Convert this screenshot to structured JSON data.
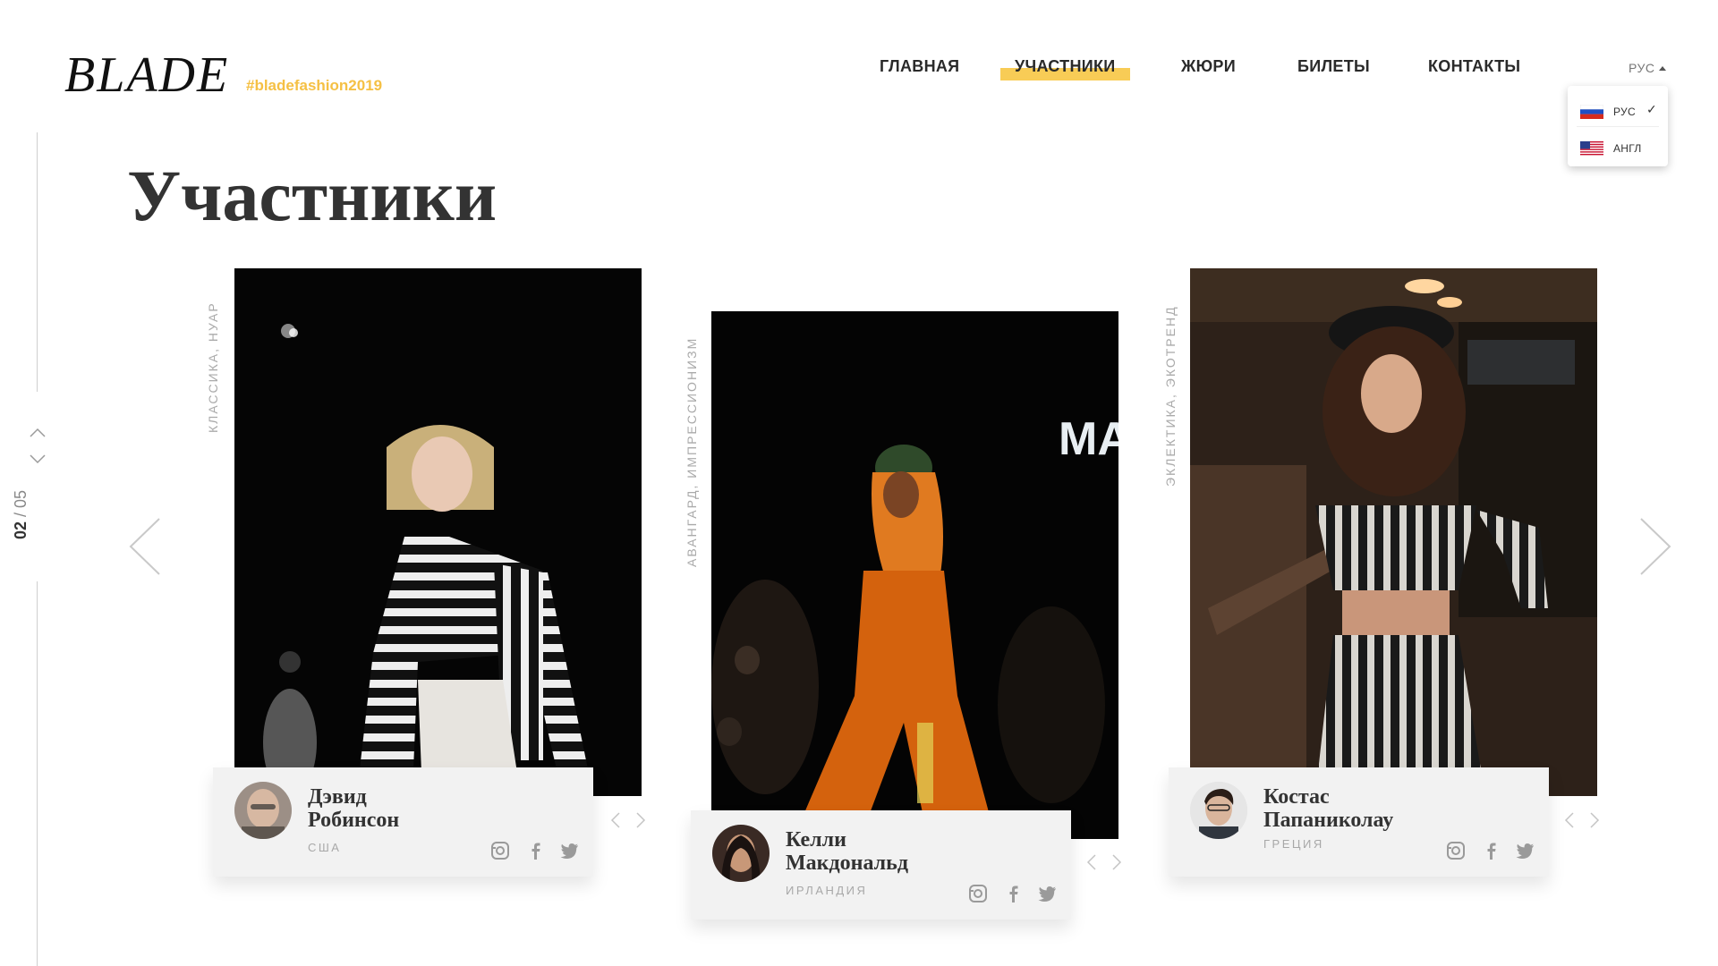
{
  "header": {
    "logo": "BLADE",
    "hashtag": "#bladefashion2019",
    "nav": [
      {
        "label": "ГЛАВНАЯ",
        "active": false
      },
      {
        "label": "УЧАСТНИКИ",
        "active": true
      },
      {
        "label": "ЖЮРИ",
        "active": false
      },
      {
        "label": "БИЛЕТЫ",
        "active": false
      },
      {
        "label": "КОНТАКТЫ",
        "active": false
      }
    ],
    "lang": {
      "current": "РУС",
      "options": [
        {
          "label": "РУС",
          "flag": "russia-flag",
          "selected": true
        },
        {
          "label": "АНГЛ",
          "flag": "usa-flag",
          "selected": false
        }
      ]
    }
  },
  "pager": {
    "current": "02",
    "separator": " / ",
    "total": "05"
  },
  "page_title": "Участники",
  "participants": [
    {
      "tags": "КЛАССИКА, НУАР",
      "name_line1": "Дэвид",
      "name_line2": "Робинсон",
      "country": "США",
      "photo": "runway-model-striped-jacket-photo"
    },
    {
      "tags": "АВАНГАРД, ИМПРЕССИОНИЗМ",
      "name_line1": "Келли",
      "name_line2": "Макдональд",
      "country": "ИРЛАНДИЯ",
      "photo": "runway-model-orange-suit-photo",
      "photo_sign": "MA"
    },
    {
      "tags": "ЭКЛЕКТИКА, ЭКОТРЕНД",
      "name_line1": "Костас",
      "name_line2": "Папаниколау",
      "country": "ГРЕЦИЯ",
      "photo": "model-striped-top-beret-photo"
    }
  ],
  "colors": {
    "accent": "#f8cc56",
    "hashtag": "#f5c044",
    "card_bg": "#f2f2f2",
    "text": "#333333"
  },
  "icons": [
    "instagram-icon",
    "facebook-icon",
    "twitter-icon",
    "chevron-left-icon",
    "chevron-right-icon",
    "chevron-up-icon",
    "chevron-down-icon",
    "check-icon"
  ]
}
